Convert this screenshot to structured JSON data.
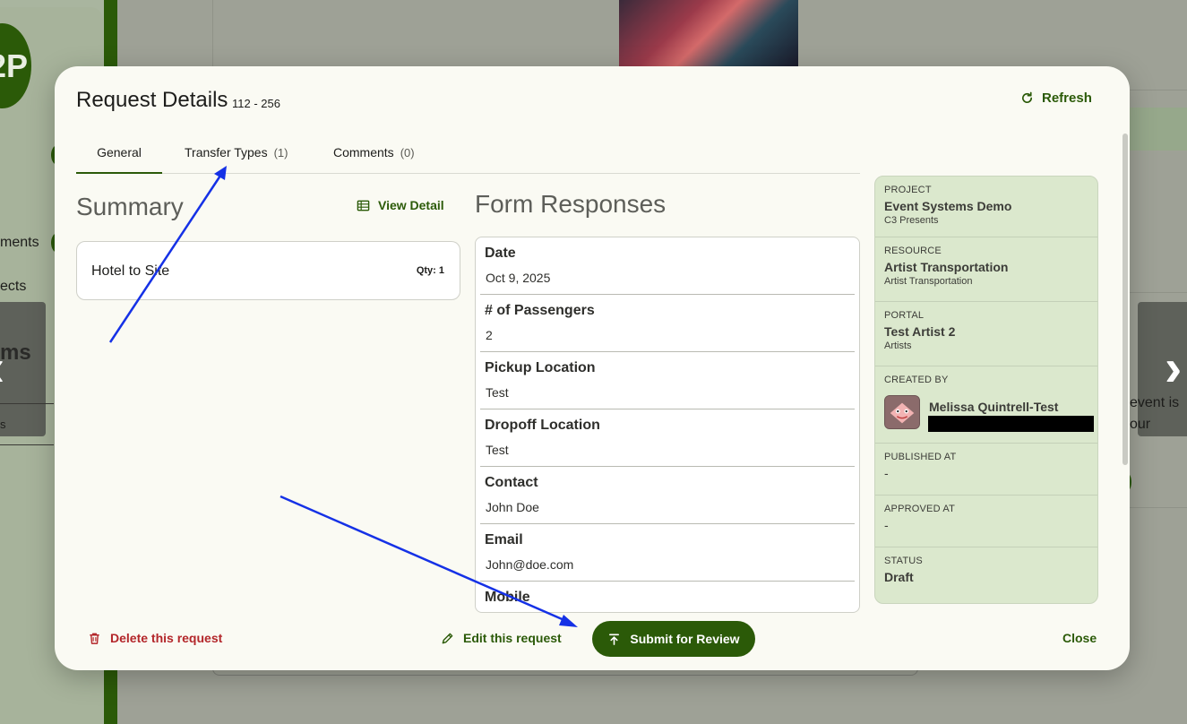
{
  "background": {
    "logo_text": "2P",
    "nav_fragments": [
      "ments",
      "ects"
    ],
    "left_card_text": "ms",
    "left_card_tab": "s",
    "right_card_text_1": "event is",
    "right_card_text_2": "our"
  },
  "modal": {
    "title": "Request Details",
    "subtitle": "112 - 256",
    "refresh_label": "Refresh"
  },
  "tabs": [
    {
      "label": "General",
      "count": ""
    },
    {
      "label": "Transfer Types",
      "count": "(1)"
    },
    {
      "label": "Comments",
      "count": "(0)"
    }
  ],
  "summary": {
    "title": "Summary",
    "view_detail_label": "View Detail",
    "items": [
      {
        "name": "Hotel to Site",
        "qty": "Qty: 1"
      }
    ]
  },
  "form": {
    "title": "Form Responses",
    "fields": [
      {
        "label": "Date",
        "value": "Oct 9, 2025"
      },
      {
        "label": "# of Passengers",
        "value": "2"
      },
      {
        "label": "Pickup Location",
        "value": "Test"
      },
      {
        "label": "Dropoff Location",
        "value": "Test"
      },
      {
        "label": "Contact",
        "value": "John Doe"
      },
      {
        "label": "Email",
        "value": "John@doe.com"
      },
      {
        "label": "Mobile",
        "value": ""
      }
    ]
  },
  "info": {
    "project": {
      "key": "PROJECT",
      "value": "Event Systems Demo",
      "sub": "C3 Presents"
    },
    "resource": {
      "key": "RESOURCE",
      "value": "Artist Transportation",
      "sub": "Artist Transportation"
    },
    "portal": {
      "key": "PORTAL",
      "value": "Test Artist 2",
      "sub": "Artists"
    },
    "created_by": {
      "key": "CREATED BY",
      "value": "Melissa Quintrell-Test"
    },
    "published_at": {
      "key": "PUBLISHED AT",
      "value": "-"
    },
    "approved_at": {
      "key": "APPROVED AT",
      "value": "-"
    },
    "status": {
      "key": "STATUS",
      "value": "Draft"
    }
  },
  "footer": {
    "delete_label": "Delete this request",
    "edit_label": "Edit this request",
    "submit_label": "Submit for Review",
    "close_label": "Close"
  },
  "colors": {
    "accent_green": "#2b5a08",
    "danger_red": "#b3262a",
    "panel_green": "#dbe8cd",
    "annotation_arrow": "#1531e6"
  }
}
